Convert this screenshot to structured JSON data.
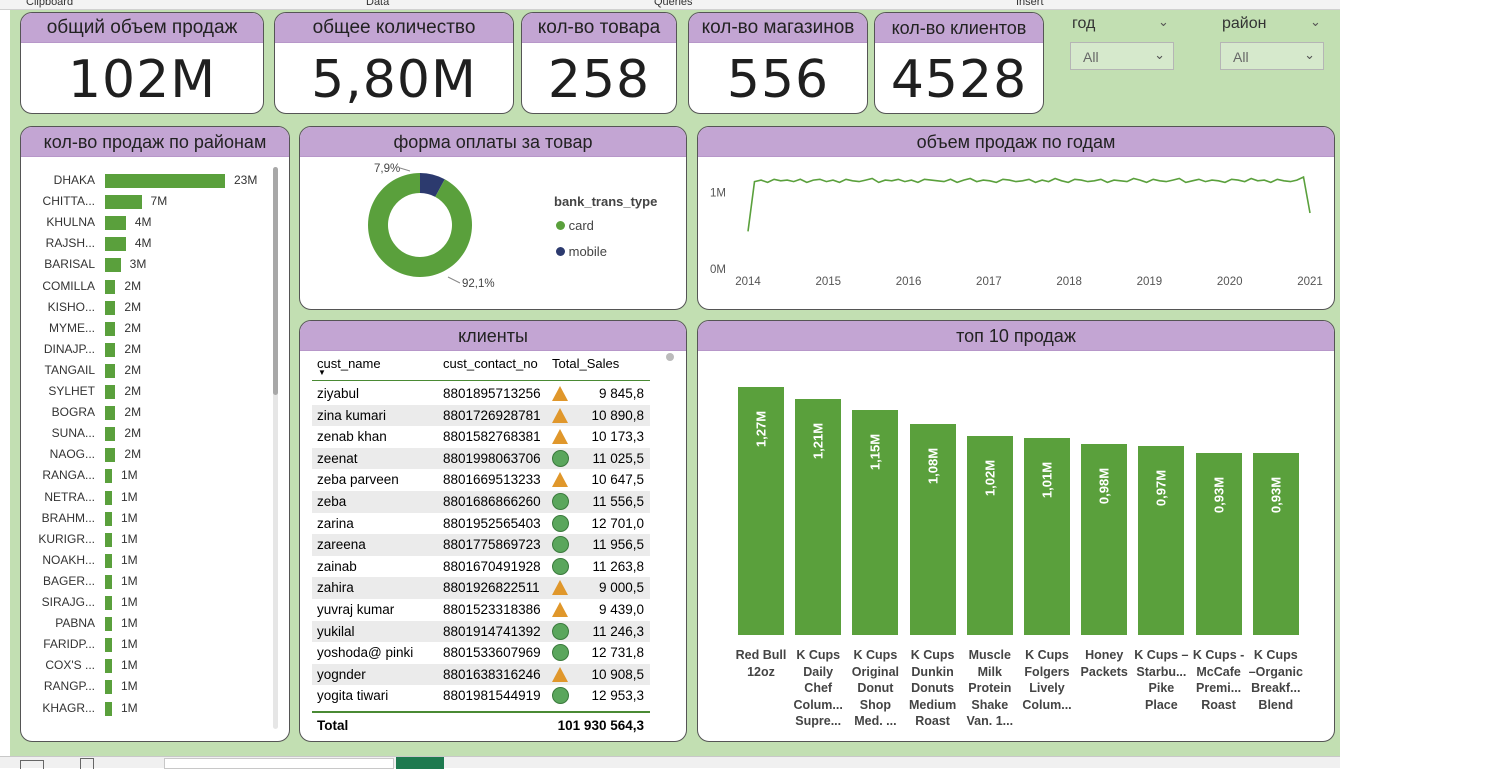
{
  "ribbon": [
    "Clipboard",
    "Data",
    "Queries",
    "Insert"
  ],
  "kpis": [
    {
      "title": "общий объем продаж",
      "value": "102M"
    },
    {
      "title": "общее количество",
      "value": "5,80M"
    },
    {
      "title": "кол-во товара",
      "value": "258"
    },
    {
      "title": "кол-во магазинов",
      "value": "556"
    },
    {
      "title": "кол-во клиентов",
      "value": "4528"
    }
  ],
  "slicers": [
    {
      "label": "год",
      "value": "All"
    },
    {
      "label": "район",
      "value": "All"
    }
  ],
  "district_chart": {
    "title": "кол-во продаж по районам",
    "chart_data": {
      "type": "bar",
      "orientation": "horizontal",
      "categories": [
        "DHAKA",
        "CHITTA...",
        "KHULNA",
        "RAJSH...",
        "BARISAL",
        "COMILLA",
        "KISHO...",
        "MYME...",
        "DINAJP...",
        "TANGAIL",
        "SYLHET",
        "BOGRA",
        "SUNA...",
        "NAOG...",
        "RANGA...",
        "NETRA...",
        "BRAHM...",
        "KURIGR...",
        "NOAKH...",
        "BAGER...",
        "SIRAJG...",
        "PABNA",
        "FARIDP...",
        "COX'S ...",
        "RANGP...",
        "KHAGR..."
      ],
      "values": [
        23,
        7,
        4,
        4,
        3,
        2,
        2,
        2,
        2,
        2,
        2,
        2,
        2,
        2,
        1,
        1,
        1,
        1,
        1,
        1,
        1,
        1,
        1,
        1,
        1,
        1
      ],
      "labels": [
        "23M",
        "7M",
        "4M",
        "4M",
        "3M",
        "2M",
        "2M",
        "2M",
        "2M",
        "2M",
        "2M",
        "2M",
        "2M",
        "2M",
        "1M",
        "1M",
        "1M",
        "1M",
        "1M",
        "1M",
        "1M",
        "1M",
        "1M",
        "1M",
        "1M",
        "1M"
      ]
    }
  },
  "payment_chart": {
    "title": "форма оплаты за товар",
    "legend_title": "bank_trans_type",
    "chart_data": {
      "type": "pie",
      "donut": true,
      "categories": [
        "card",
        "mobile"
      ],
      "values": [
        92.1,
        7.9
      ],
      "labels": [
        "92,1%",
        "7,9%"
      ],
      "colors": [
        "#5aa03c",
        "#2c3a6e"
      ]
    }
  },
  "year_chart": {
    "title": "объем продаж по годам",
    "chart_data": {
      "type": "line",
      "x_ticks": [
        "2014",
        "2015",
        "2016",
        "2017",
        "2018",
        "2019",
        "2020",
        "2021"
      ],
      "y_ticks": [
        "0M",
        "1M"
      ],
      "ylim": [
        0,
        1.2
      ],
      "color": "#5aa03c",
      "values": [
        0.49,
        1.14,
        1.16,
        1.13,
        1.17,
        1.15,
        1.16,
        1.14,
        1.17,
        1.13,
        1.16,
        1.17,
        1.14,
        1.16,
        1.13,
        1.17,
        1.15,
        1.14,
        1.16,
        1.18,
        1.13,
        1.16,
        1.15,
        1.17,
        1.14,
        1.16,
        1.13,
        1.17,
        1.16,
        1.15,
        1.14,
        1.17,
        1.13,
        1.16,
        1.18,
        1.14,
        1.16,
        1.15,
        1.13,
        1.17,
        1.16,
        1.14,
        1.15,
        1.17,
        1.13,
        1.16,
        1.14,
        1.18,
        1.15,
        1.13,
        1.17,
        1.16,
        1.14,
        1.15,
        1.17,
        1.13,
        1.16,
        1.15,
        1.14,
        1.18,
        1.16,
        1.13,
        1.17,
        1.15,
        1.14,
        1.16,
        1.18,
        1.13,
        1.15,
        1.17,
        1.14,
        1.16,
        1.15,
        1.13,
        1.17,
        1.16,
        1.14,
        1.18,
        1.15,
        1.16,
        1.13,
        1.17,
        1.15,
        1.14,
        1.16,
        1.2,
        0.73
      ]
    }
  },
  "clients": {
    "title": "клиенты",
    "columns": [
      "cust_name",
      "cust_contact_no",
      "Total_Sales"
    ],
    "rows": [
      {
        "name": "ziyabul",
        "contact": "8801895713256",
        "icon": "triangle",
        "sales": "9 845,8"
      },
      {
        "name": "zina kumari",
        "contact": "8801726928781",
        "icon": "triangle",
        "sales": "10 890,8"
      },
      {
        "name": "zenab khan",
        "contact": "8801582768381",
        "icon": "triangle",
        "sales": "10 173,3"
      },
      {
        "name": "zeenat",
        "contact": "8801998063706",
        "icon": "circle",
        "sales": "11 025,5"
      },
      {
        "name": "zeba parveen",
        "contact": "8801669513233",
        "icon": "triangle",
        "sales": "10 647,5"
      },
      {
        "name": "zeba",
        "contact": "8801686866260",
        "icon": "circle",
        "sales": "11 556,5"
      },
      {
        "name": "zarina",
        "contact": "8801952565403",
        "icon": "circle",
        "sales": "12 701,0"
      },
      {
        "name": "zareena",
        "contact": "8801775869723",
        "icon": "circle",
        "sales": "11 956,5"
      },
      {
        "name": "zainab",
        "contact": "8801670491928",
        "icon": "circle",
        "sales": "11 263,8"
      },
      {
        "name": "zahira",
        "contact": "8801926822511",
        "icon": "triangle",
        "sales": "9 000,5"
      },
      {
        "name": "yuvraj kumar",
        "contact": "8801523318386",
        "icon": "triangle",
        "sales": "9 439,0"
      },
      {
        "name": "yukilal",
        "contact": "8801914741392",
        "icon": "circle",
        "sales": "11 246,3"
      },
      {
        "name": "yoshoda@ pinki",
        "contact": "8801533607969",
        "icon": "circle",
        "sales": "12 731,8"
      },
      {
        "name": "yognder",
        "contact": "8801638316246",
        "icon": "triangle",
        "sales": "10 908,5"
      },
      {
        "name": "yogita tiwari",
        "contact": "8801981544919",
        "icon": "circle",
        "sales": "12 953,3"
      }
    ],
    "total_label": "Total",
    "total_value": "101 930 564,3"
  },
  "top_chart": {
    "title": "топ 10 продаж",
    "chart_data": {
      "type": "bar",
      "ylim": [
        0,
        1.4
      ],
      "color": "#5aa03c",
      "categories": [
        [
          "Red Bull",
          "12oz"
        ],
        [
          "K Cups",
          "Daily",
          "Chef",
          "Colum...",
          "Supre..."
        ],
        [
          "K Cups",
          "Original",
          "Donut",
          "Shop",
          "Med. ..."
        ],
        [
          "K Cups",
          "Dunkin",
          "Donuts",
          "Medium",
          "Roast"
        ],
        [
          "Muscle",
          "Milk",
          "Protein",
          "Shake",
          "Van. 1..."
        ],
        [
          "K Cups",
          "Folgers",
          "Lively",
          "Colum..."
        ],
        [
          "Honey",
          "Packets"
        ],
        [
          "K Cups –",
          "Starbu...",
          "Pike",
          "Place"
        ],
        [
          "K Cups -",
          "McCafe",
          "Premi...",
          "Roast"
        ],
        [
          "K Cups",
          "–Organic",
          "Breakf...",
          "Blend"
        ]
      ],
      "values": [
        1.27,
        1.21,
        1.15,
        1.08,
        1.02,
        1.01,
        0.98,
        0.97,
        0.93,
        0.93
      ],
      "labels": [
        "1,27M",
        "1,21M",
        "1,15M",
        "1,08M",
        "1,02M",
        "1,01M",
        "0,98M",
        "0,97M",
        "0,93M",
        "0,93M"
      ]
    }
  }
}
